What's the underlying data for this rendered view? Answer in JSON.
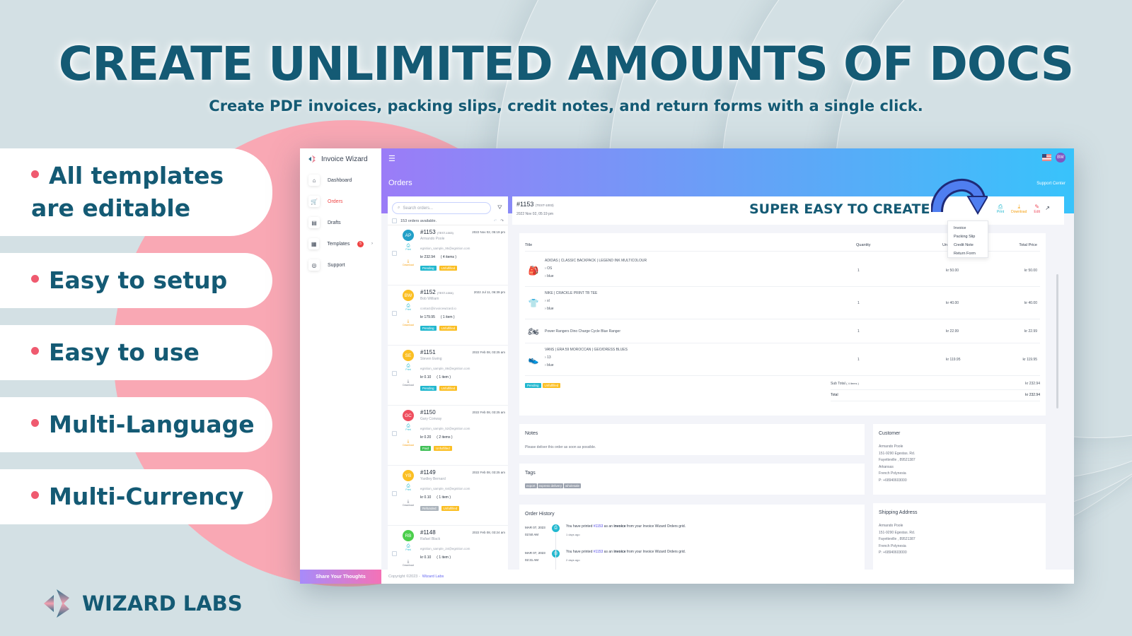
{
  "banner": {
    "headline": "CREATE UNLIMITED AMOUNTS OF DOCS",
    "subline": "Create PDF invoices, packing slips, credit notes, and return forms with a single click.",
    "features": [
      "All templates are editable",
      "Easy to setup",
      "Easy to use",
      "Multi-Language",
      "Multi-Currency"
    ],
    "brand": "WIZARD LABS",
    "callout": "SUPER EASY TO CREATE",
    "colors": {
      "primary": "#145a74",
      "accent": "#ef5a6f",
      "pink": "#f9a8b4"
    }
  },
  "app": {
    "name": "Invoice Wizard",
    "nav": [
      {
        "label": "Dashboard",
        "icon": "home-icon"
      },
      {
        "label": "Orders",
        "icon": "cart-icon",
        "active": true
      },
      {
        "label": "Drafts",
        "icon": "document-icon"
      },
      {
        "label": "Templates",
        "icon": "template-icon",
        "badge": "5"
      },
      {
        "label": "Support",
        "icon": "lifebuoy-icon"
      }
    ],
    "share_label": "Share Your Thoughts",
    "page_title": "Orders",
    "support_link": "Support Center",
    "user_initials": "BW",
    "search_placeholder": "Search orders...",
    "orders_available": "153 orders available.",
    "print_label": "Print",
    "download_label": "Download",
    "orders": [
      {
        "initials": "AP",
        "color": "#22a0c8",
        "number": "#1153",
        "test": "(TEST-1003)",
        "date": "2022 Nov 02, 05:19 pm",
        "name": "Armando Poole",
        "email": "egnition_sample_95@egnition.com",
        "amount": "kr 232.94",
        "items": "( 4 items )",
        "payment": "Pending",
        "fulfillment": "Unfulfilled"
      },
      {
        "initials": "BW",
        "color": "#fbbf24",
        "number": "#1152",
        "test": "(TEST-1004)",
        "date": "2022 Jul 11, 06:39 pm",
        "name": "Bob William",
        "email": "contact@invoicewizard.io",
        "amount": "kr 179.95",
        "items": "( 1 item )",
        "payment": "Pending",
        "fulfillment": "Unfulfilled"
      },
      {
        "initials": "SE",
        "color": "#fbbf24",
        "number": "#1151",
        "test": "",
        "date": "2022 Feb 08, 03:25 am",
        "name": "Steven Ewing",
        "email": "egnition_sample_86@egnition.com",
        "amount": "kr 0.10",
        "items": "( 1 item )",
        "payment": "Pending",
        "fulfillment": "Unfulfilled"
      },
      {
        "initials": "GC",
        "color": "#ef4f5f",
        "number": "#1150",
        "test": "",
        "date": "2022 Feb 08, 03:25 am",
        "name": "Gary Conway",
        "email": "egnition_sample_52@egnition.com",
        "amount": "kr 0.20",
        "items": "( 2 items )",
        "payment": "Paid",
        "fulfillment": "Unfulfilled"
      },
      {
        "initials": "YB",
        "color": "#fbbf24",
        "number": "#1149",
        "test": "",
        "date": "2022 Feb 08, 03:25 am",
        "name": "Yardley Bernard",
        "email": "egnition_sample_64@egnition.com",
        "amount": "kr 0.10",
        "items": "( 1 item )",
        "payment": "Refunded",
        "fulfillment": "Unfulfilled"
      },
      {
        "initials": "RB",
        "color": "#4ccf4c",
        "number": "#1148",
        "test": "",
        "date": "2022 Feb 08, 03:24 am",
        "name": "Rafael Black",
        "email": "egnition_sample_24@egnition.com",
        "amount": "kr 0.10",
        "items": "( 1 item )",
        "payment": "",
        "fulfillment": ""
      }
    ],
    "status_colors": {
      "Pending": "#22b8cf",
      "Unfulfilled": "#fbbf24",
      "Paid": "#40c057",
      "Refunded": "#adb5bd"
    },
    "detail": {
      "number": "#1153",
      "test": "(TEST-1003)",
      "date": "2022 Nov 02, 05:19 pm",
      "actions": [
        {
          "label": "Print",
          "color": "#22b8cf",
          "icon": "printer-icon"
        },
        {
          "label": "Download",
          "color": "#f59e0b",
          "icon": "download-icon"
        },
        {
          "label": "Edit",
          "color": "#ef4f5f",
          "icon": "edit-icon"
        }
      ],
      "menu": [
        "Invoice",
        "Packing Slip",
        "Credit Note",
        "Return Form"
      ],
      "columns": [
        "Title",
        "Quantity",
        "Unit Price",
        "Total Price"
      ],
      "line_items": [
        {
          "title": "ADIDAS | CLASSIC BACKPACK | LEGEND INK MULTICOLOUR",
          "variants": [
            "OS",
            "blue"
          ],
          "qty": "1",
          "unit": "kr 50.00",
          "total": "kr 50.00",
          "thumb": "backpack-icon"
        },
        {
          "title": "NIKE | CRACKLE PRINT TB TEE",
          "variants": [
            "xl",
            "blue"
          ],
          "qty": "1",
          "unit": "kr 40.00",
          "total": "kr 40.00",
          "thumb": "tshirt-icon"
        },
        {
          "title": "Power Rangers Dino Charge Cycle Blue Ranger",
          "variants": [],
          "qty": "1",
          "unit": "kr 22.99",
          "total": "kr 22.99",
          "thumb": "toy-icon"
        },
        {
          "title": "VANS | ERA 59 MOROCCAN | GEO/DRESS BLUES",
          "variants": [
            "13",
            "blue"
          ],
          "qty": "1",
          "unit": "kr 119.95",
          "total": "kr 119.95",
          "thumb": "shoe-icon"
        }
      ],
      "payment": "Pending",
      "fulfillment": "Unfulfilled",
      "subtotal_label": "Sub Total",
      "subtotal_items": "( 4 items )",
      "subtotal": "kr 232.94",
      "total_label": "Total",
      "total": "kr 232.94",
      "notes_title": "Notes",
      "notes": "Please deliver this order as soon as possible.",
      "tags_title": "Tags",
      "tags": [
        "export",
        "express delivery",
        "wholesale"
      ],
      "history_title": "Order History",
      "history": [
        {
          "date": "MAR 07, 2023",
          "time": "02:50 AM",
          "pre": "You have printed ",
          "link": "#1153",
          "mid": " as an ",
          "bold": "invoice",
          "post": " from your Invoice Wizard Orders grid.",
          "ago": "1 days ago"
        },
        {
          "date": "MAR 07, 2023",
          "time": "02:31 AM",
          "pre": "You have printed ",
          "link": "#1153",
          "mid": " as an ",
          "bold": "invoice",
          "post": " from your Invoice Wizard Orders grid.",
          "ago": "2 days ago"
        }
      ],
      "customer_title": "Customer",
      "customer": [
        "Armando Poole",
        "151-9290 Egestas. Rd.",
        "Fayetteville , 89521387",
        "Arkansas",
        "French Polynesia",
        "P: +68940603000"
      ],
      "shipping_title": "Shipping Address",
      "shipping": [
        "Armando Poole",
        "151-9290 Egestas. Rd.",
        "Fayetteville , 89521387",
        "French Polynesia",
        "P: +68940603000"
      ]
    },
    "footer_text": "Copyright ©2023 -",
    "footer_link": "Wizard Labs"
  }
}
